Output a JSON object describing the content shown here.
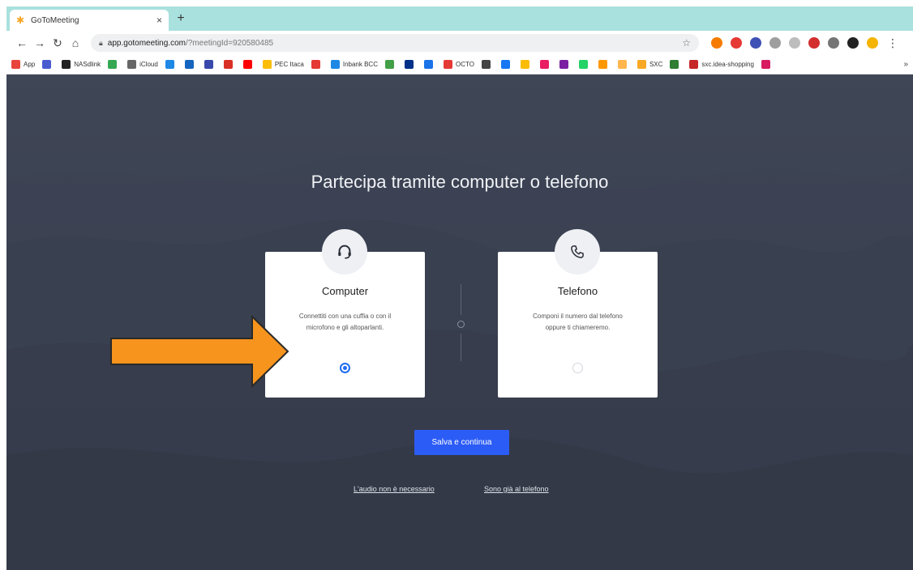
{
  "browser": {
    "tab_title": "GoToMeeting",
    "tab_close": "×",
    "new_tab": "+",
    "url_host": "app.gotomeeting.com",
    "url_rest": "/?meetingId=920580485",
    "bookmarks": [
      {
        "label": "App",
        "color": "#e8453c"
      },
      {
        "label": "",
        "color": "#4a5bd0"
      },
      {
        "label": "NASdlink",
        "color": "#222222"
      },
      {
        "label": "",
        "color": "#34a853"
      },
      {
        "label": "iCloud",
        "color": "#666666"
      },
      {
        "label": "",
        "color": "#1e88e5"
      },
      {
        "label": "",
        "color": "#1565c0"
      },
      {
        "label": "",
        "color": "#3949ab"
      },
      {
        "label": "",
        "color": "#d93025"
      },
      {
        "label": "",
        "color": "#ff0000"
      },
      {
        "label": "PEC Itaca",
        "color": "#fbbc04"
      },
      {
        "label": "",
        "color": "#e53935"
      },
      {
        "label": "Inbank BCC",
        "color": "#1e88e5"
      },
      {
        "label": "",
        "color": "#43a047"
      },
      {
        "label": "",
        "color": "#003087"
      },
      {
        "label": "",
        "color": "#1a73e8"
      },
      {
        "label": "OCTO",
        "color": "#e53935"
      },
      {
        "label": "",
        "color": "#444444"
      },
      {
        "label": "",
        "color": "#1877f2"
      },
      {
        "label": "",
        "color": "#fbbc04"
      },
      {
        "label": "",
        "color": "#e91e63"
      },
      {
        "label": "",
        "color": "#7b1fa2"
      },
      {
        "label": "",
        "color": "#25d366"
      },
      {
        "label": "",
        "color": "#ff9800"
      },
      {
        "label": "",
        "color": "#ffb74d"
      },
      {
        "label": "SXC",
        "color": "#f9a825"
      },
      {
        "label": "",
        "color": "#2e7d32"
      },
      {
        "label": "sxc.idea-shopping",
        "color": "#c62828"
      },
      {
        "label": "",
        "color": "#d81b60"
      }
    ],
    "bookmarks_more": "»"
  },
  "page": {
    "heading": "Partecipa tramite computer o telefono",
    "computer": {
      "title": "Computer",
      "description": "Connettiti con una cuffia o con il microfono e gli altoparlanti.",
      "selected": true
    },
    "phone": {
      "title": "Telefono",
      "description": "Componi il numero dal telefono oppure ti chiameremo.",
      "selected": false
    },
    "save_button": "Salva e continua",
    "no_audio_link": "L'audio non è necessario",
    "on_phone_link": "Sono già al telefono"
  },
  "colors": {
    "accent": "#2c5cf6",
    "arrow": "#f7941d",
    "tabstrip": "#a9e1de"
  }
}
